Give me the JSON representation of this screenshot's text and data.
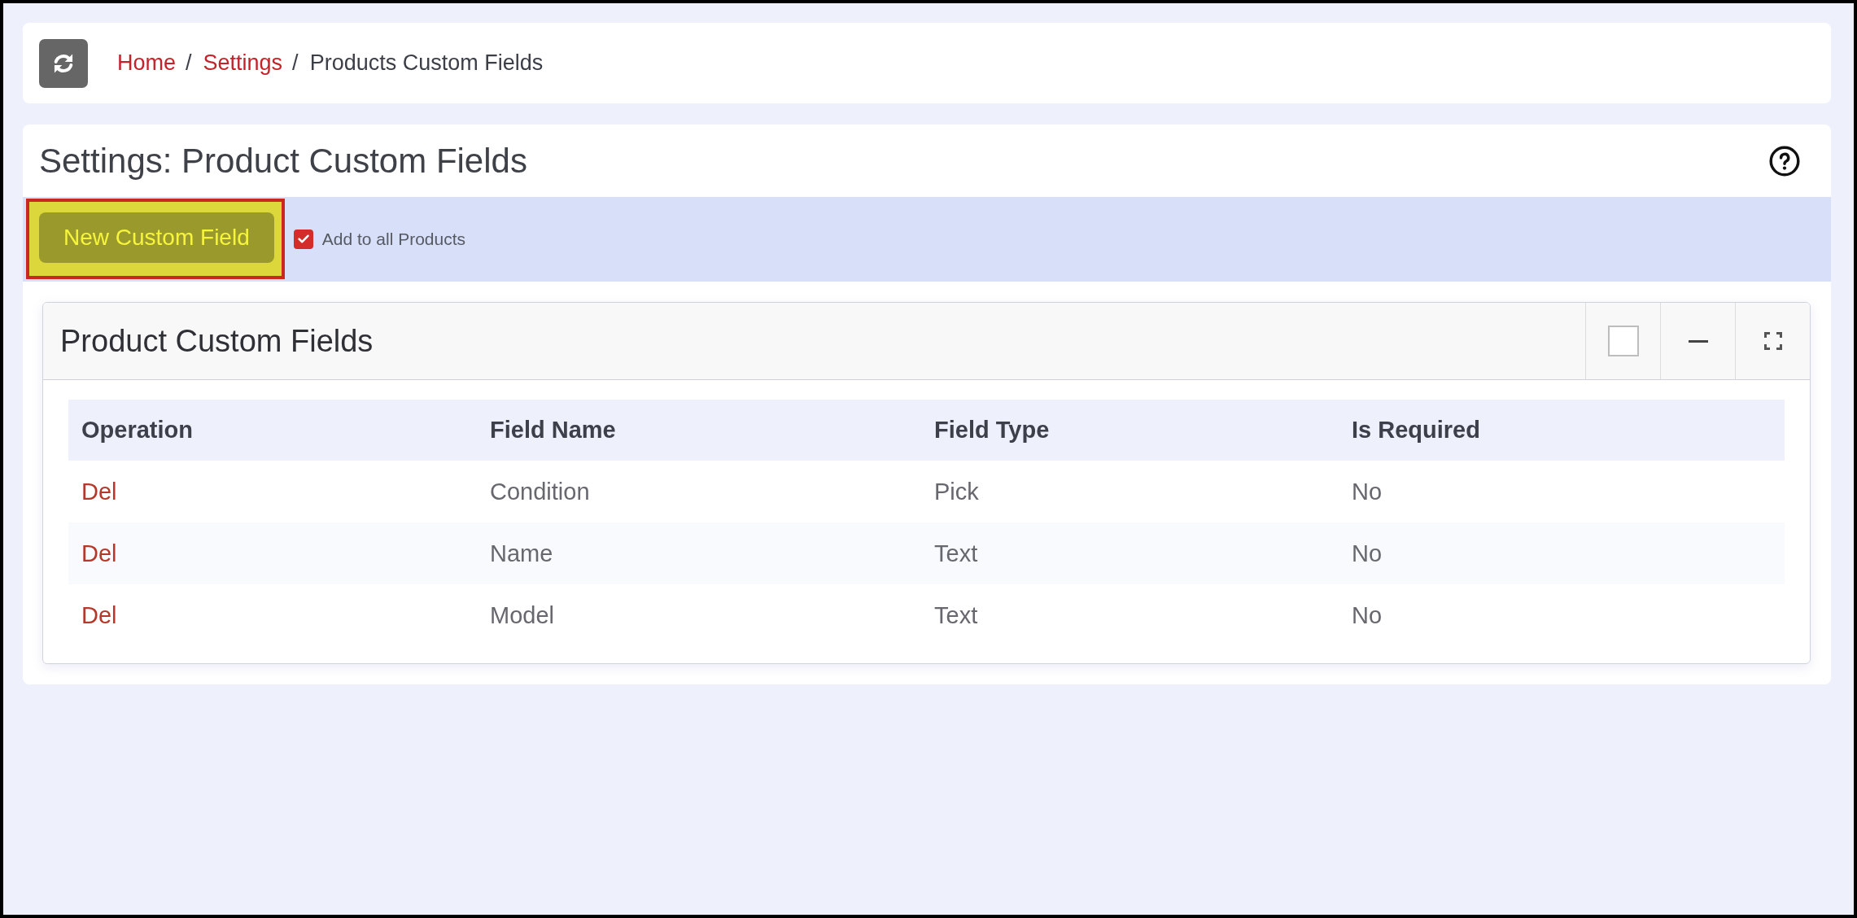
{
  "breadcrumb": [
    {
      "label": "Home",
      "kind": "link",
      "separator": "/"
    },
    {
      "label": "Settings",
      "kind": "link",
      "separator": "/"
    },
    {
      "label": "Products Custom Fields",
      "kind": "current"
    }
  ],
  "page": {
    "title": "Settings: Product Custom Fields"
  },
  "toolbar": {
    "new_button": {
      "label": "New Custom Field",
      "highlighted": true
    },
    "add_to_all": {
      "label": "Add to all Products",
      "checked": true
    }
  },
  "panel": {
    "title": "Product Custom Fields",
    "table": {
      "columns": [
        "Operation",
        "Field Name",
        "Field Type",
        "Is Required"
      ],
      "rows": [
        {
          "operation": "Del",
          "field_name": "Condition",
          "field_type": "Pick",
          "is_required": "No"
        },
        {
          "operation": "Del",
          "field_name": "Name",
          "field_type": "Text",
          "is_required": "No"
        },
        {
          "operation": "Del",
          "field_name": "Model",
          "field_type": "Text",
          "is_required": "No"
        }
      ]
    }
  }
}
